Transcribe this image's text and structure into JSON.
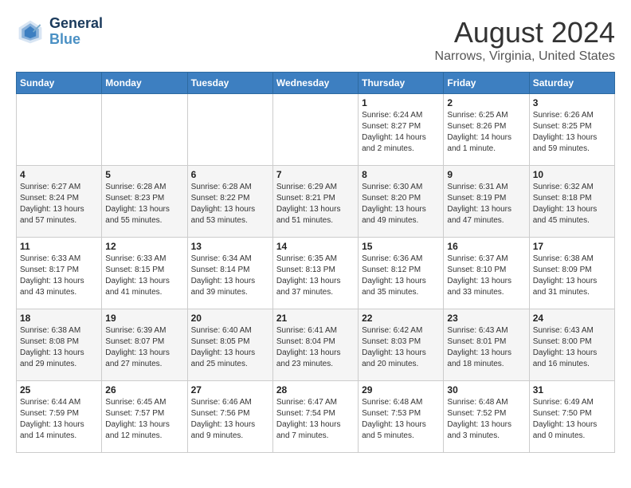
{
  "logo": {
    "line1": "General",
    "line2": "Blue"
  },
  "title": "August 2024",
  "subtitle": "Narrows, Virginia, United States",
  "weekdays": [
    "Sunday",
    "Monday",
    "Tuesday",
    "Wednesday",
    "Thursday",
    "Friday",
    "Saturday"
  ],
  "weeks": [
    [
      {
        "day": "",
        "detail": ""
      },
      {
        "day": "",
        "detail": ""
      },
      {
        "day": "",
        "detail": ""
      },
      {
        "day": "",
        "detail": ""
      },
      {
        "day": "1",
        "detail": "Sunrise: 6:24 AM\nSunset: 8:27 PM\nDaylight: 14 hours\nand 2 minutes."
      },
      {
        "day": "2",
        "detail": "Sunrise: 6:25 AM\nSunset: 8:26 PM\nDaylight: 14 hours\nand 1 minute."
      },
      {
        "day": "3",
        "detail": "Sunrise: 6:26 AM\nSunset: 8:25 PM\nDaylight: 13 hours\nand 59 minutes."
      }
    ],
    [
      {
        "day": "4",
        "detail": "Sunrise: 6:27 AM\nSunset: 8:24 PM\nDaylight: 13 hours\nand 57 minutes."
      },
      {
        "day": "5",
        "detail": "Sunrise: 6:28 AM\nSunset: 8:23 PM\nDaylight: 13 hours\nand 55 minutes."
      },
      {
        "day": "6",
        "detail": "Sunrise: 6:28 AM\nSunset: 8:22 PM\nDaylight: 13 hours\nand 53 minutes."
      },
      {
        "day": "7",
        "detail": "Sunrise: 6:29 AM\nSunset: 8:21 PM\nDaylight: 13 hours\nand 51 minutes."
      },
      {
        "day": "8",
        "detail": "Sunrise: 6:30 AM\nSunset: 8:20 PM\nDaylight: 13 hours\nand 49 minutes."
      },
      {
        "day": "9",
        "detail": "Sunrise: 6:31 AM\nSunset: 8:19 PM\nDaylight: 13 hours\nand 47 minutes."
      },
      {
        "day": "10",
        "detail": "Sunrise: 6:32 AM\nSunset: 8:18 PM\nDaylight: 13 hours\nand 45 minutes."
      }
    ],
    [
      {
        "day": "11",
        "detail": "Sunrise: 6:33 AM\nSunset: 8:17 PM\nDaylight: 13 hours\nand 43 minutes."
      },
      {
        "day": "12",
        "detail": "Sunrise: 6:33 AM\nSunset: 8:15 PM\nDaylight: 13 hours\nand 41 minutes."
      },
      {
        "day": "13",
        "detail": "Sunrise: 6:34 AM\nSunset: 8:14 PM\nDaylight: 13 hours\nand 39 minutes."
      },
      {
        "day": "14",
        "detail": "Sunrise: 6:35 AM\nSunset: 8:13 PM\nDaylight: 13 hours\nand 37 minutes."
      },
      {
        "day": "15",
        "detail": "Sunrise: 6:36 AM\nSunset: 8:12 PM\nDaylight: 13 hours\nand 35 minutes."
      },
      {
        "day": "16",
        "detail": "Sunrise: 6:37 AM\nSunset: 8:10 PM\nDaylight: 13 hours\nand 33 minutes."
      },
      {
        "day": "17",
        "detail": "Sunrise: 6:38 AM\nSunset: 8:09 PM\nDaylight: 13 hours\nand 31 minutes."
      }
    ],
    [
      {
        "day": "18",
        "detail": "Sunrise: 6:38 AM\nSunset: 8:08 PM\nDaylight: 13 hours\nand 29 minutes."
      },
      {
        "day": "19",
        "detail": "Sunrise: 6:39 AM\nSunset: 8:07 PM\nDaylight: 13 hours\nand 27 minutes."
      },
      {
        "day": "20",
        "detail": "Sunrise: 6:40 AM\nSunset: 8:05 PM\nDaylight: 13 hours\nand 25 minutes."
      },
      {
        "day": "21",
        "detail": "Sunrise: 6:41 AM\nSunset: 8:04 PM\nDaylight: 13 hours\nand 23 minutes."
      },
      {
        "day": "22",
        "detail": "Sunrise: 6:42 AM\nSunset: 8:03 PM\nDaylight: 13 hours\nand 20 minutes."
      },
      {
        "day": "23",
        "detail": "Sunrise: 6:43 AM\nSunset: 8:01 PM\nDaylight: 13 hours\nand 18 minutes."
      },
      {
        "day": "24",
        "detail": "Sunrise: 6:43 AM\nSunset: 8:00 PM\nDaylight: 13 hours\nand 16 minutes."
      }
    ],
    [
      {
        "day": "25",
        "detail": "Sunrise: 6:44 AM\nSunset: 7:59 PM\nDaylight: 13 hours\nand 14 minutes."
      },
      {
        "day": "26",
        "detail": "Sunrise: 6:45 AM\nSunset: 7:57 PM\nDaylight: 13 hours\nand 12 minutes."
      },
      {
        "day": "27",
        "detail": "Sunrise: 6:46 AM\nSunset: 7:56 PM\nDaylight: 13 hours\nand 9 minutes."
      },
      {
        "day": "28",
        "detail": "Sunrise: 6:47 AM\nSunset: 7:54 PM\nDaylight: 13 hours\nand 7 minutes."
      },
      {
        "day": "29",
        "detail": "Sunrise: 6:48 AM\nSunset: 7:53 PM\nDaylight: 13 hours\nand 5 minutes."
      },
      {
        "day": "30",
        "detail": "Sunrise: 6:48 AM\nSunset: 7:52 PM\nDaylight: 13 hours\nand 3 minutes."
      },
      {
        "day": "31",
        "detail": "Sunrise: 6:49 AM\nSunset: 7:50 PM\nDaylight: 13 hours\nand 0 minutes."
      }
    ]
  ]
}
